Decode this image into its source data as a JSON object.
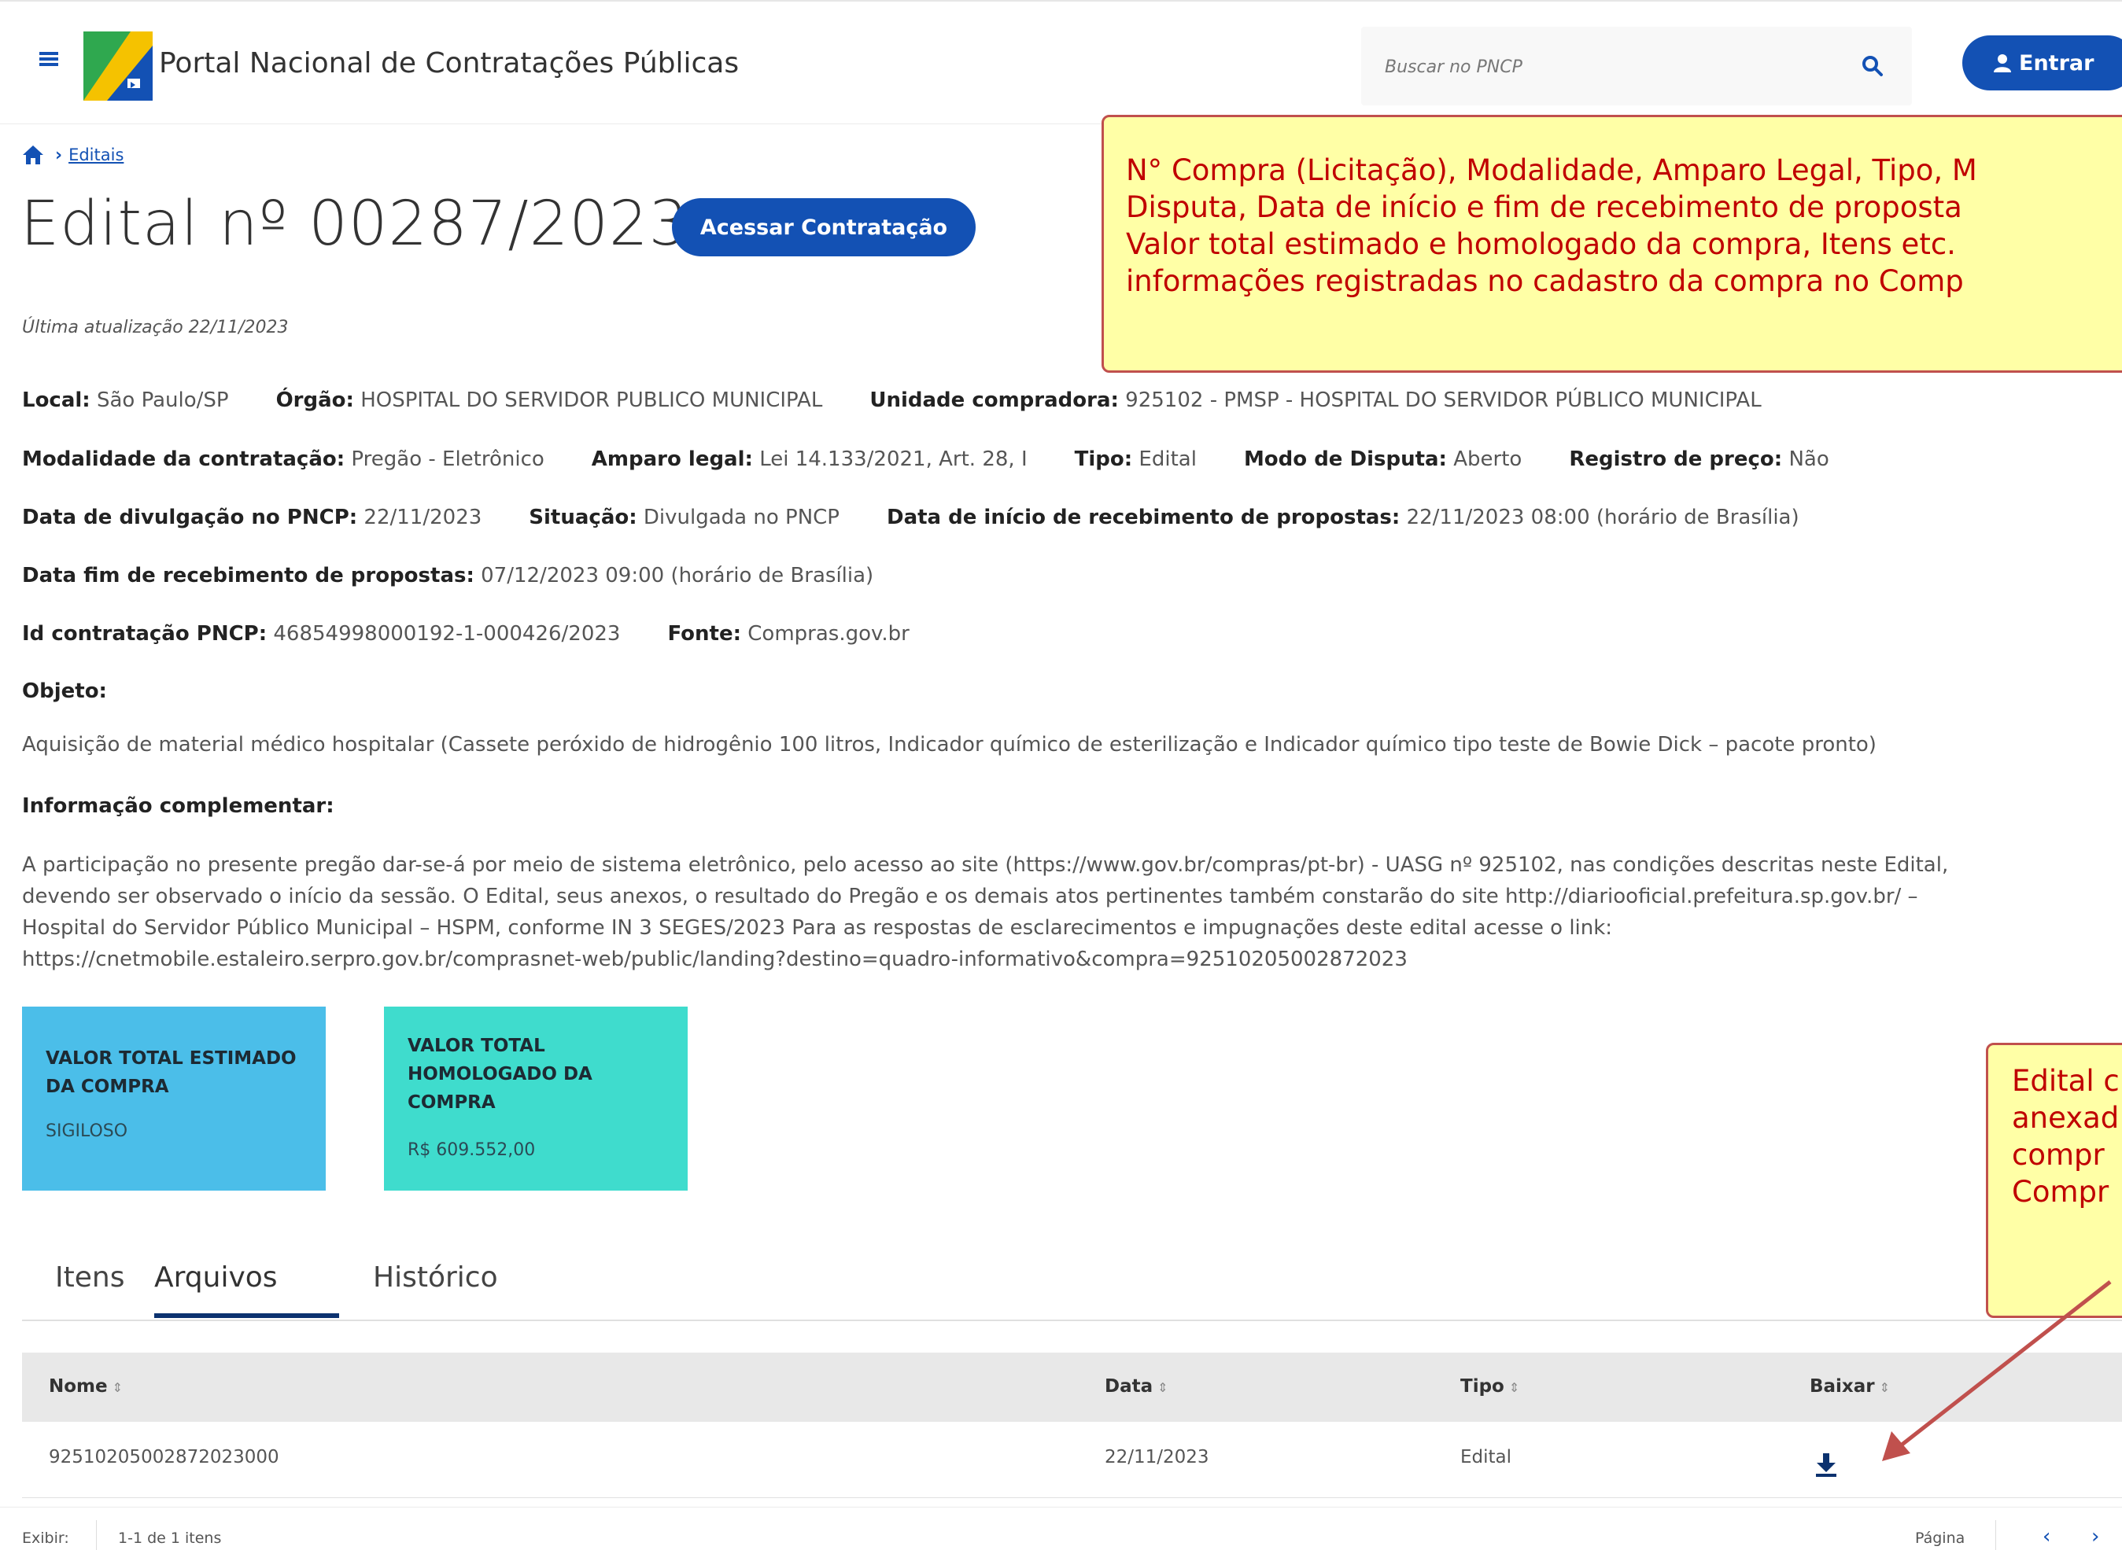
{
  "header": {
    "portal_title": "Portal Nacional de Contratações Públicas",
    "search_placeholder": "Buscar no PNCP",
    "login_label": "Entrar"
  },
  "breadcrumb": {
    "link": "Editais"
  },
  "page": {
    "title": "Edital nº 00287/2023",
    "access_button": "Acessar Contratação",
    "last_update": "Última atualização 22/11/2023"
  },
  "info": {
    "local_label": "Local:",
    "local_value": "São Paulo/SP",
    "orgao_label": "Órgão:",
    "orgao_value": "HOSPITAL DO SERVIDOR PUBLICO MUNICIPAL",
    "unidade_label": "Unidade compradora:",
    "unidade_value": "925102 - PMSP - HOSPITAL DO SERVIDOR PÚBLICO MUNICIPAL",
    "modalidade_label": "Modalidade da contratação:",
    "modalidade_value": "Pregão - Eletrônico",
    "amparo_label": "Amparo legal:",
    "amparo_value": "Lei 14.133/2021, Art. 28, I",
    "tipo_label": "Tipo:",
    "tipo_value": "Edital",
    "modo_label": "Modo de Disputa:",
    "modo_value": "Aberto",
    "registro_label": "Registro de preço:",
    "registro_value": "Não",
    "divulgacao_label": "Data de divulgação no PNCP:",
    "divulgacao_value": "22/11/2023",
    "situacao_label": "Situação:",
    "situacao_value": "Divulgada no PNCP",
    "inicio_label": "Data de início de recebimento de propostas:",
    "inicio_value": "22/11/2023 08:00 (horário de Brasília)",
    "fim_label": "Data fim de recebimento de propostas:",
    "fim_value": "07/12/2023 09:00 (horário de Brasília)",
    "id_label": "Id contratação PNCP:",
    "id_value": "46854998000192-1-000426/2023",
    "fonte_label": "Fonte:",
    "fonte_value": "Compras.gov.br",
    "objeto_label": "Objeto:",
    "objeto_value": "Aquisição de material médico hospitalar (Cassete peróxido de hidrogênio 100 litros, Indicador químico de esterilização e Indicador químico tipo teste de Bowie Dick – pacote pronto)",
    "complementar_label": "Informação complementar:",
    "complementar_lines": [
      "A participação no presente pregão dar-se-á por meio de sistema eletrônico, pelo acesso ao site (https://www.gov.br/compras/pt-br) - UASG nº 925102, nas condições descritas neste Edital,",
      "devendo ser observado o início da sessão. O Edital, seus anexos, o resultado do Pregão e os demais atos pertinentes também constarão do site http://diariooficial.prefeitura.sp.gov.br/ –",
      "Hospital do Servidor Público Municipal – HSPM, conforme IN 3 SEGES/2023 Para as respostas de esclarecimentos e impugnações deste edital acesse o link:",
      "https://cnetmobile.estaleiro.serpro.gov.br/comprasnet-web/public/landing?destino=quadro-informativo&compra=92510205002872023"
    ]
  },
  "cards": {
    "estimado_label_1": "VALOR TOTAL ESTIMADO",
    "estimado_label_2": "DA COMPRA",
    "estimado_value": "SIGILOSO",
    "homologado_label_1": "VALOR TOTAL",
    "homologado_label_2": "HOMOLOGADO DA",
    "homologado_label_3": "COMPRA",
    "homologado_value": "R$ 609.552,00"
  },
  "tabs": {
    "itens": "Itens",
    "arquivos": "Arquivos",
    "historico": "Histórico"
  },
  "table": {
    "headers": {
      "nome": "Nome",
      "data": "Data",
      "tipo": "Tipo",
      "baixar": "Baixar"
    },
    "rows": [
      {
        "nome": "92510205002872023000",
        "data": "22/11/2023",
        "tipo": "Edital"
      }
    ]
  },
  "footer": {
    "exibir": "Exibir:",
    "count": "1-1 de 1 itens",
    "pagina": "Página"
  },
  "annotations": {
    "top_lines": [
      "N° Compra (Licitação), Modalidade, Amparo Legal, Tipo, M",
      "Disputa, Data de início e fim de recebimento de proposta",
      "Valor total estimado e homologado da compra, Itens etc.",
      "informações registradas no cadastro da compra no Comp"
    ],
    "bottom_lines": [
      "Edital c",
      "anexad",
      "compr",
      "Compr"
    ]
  },
  "colors": {
    "primary": "#1351b4",
    "card_blue": "#4bbee9",
    "card_teal": "#3fdccd",
    "annotation_bg": "#ffffa6",
    "annotation_text": "#c00000"
  }
}
